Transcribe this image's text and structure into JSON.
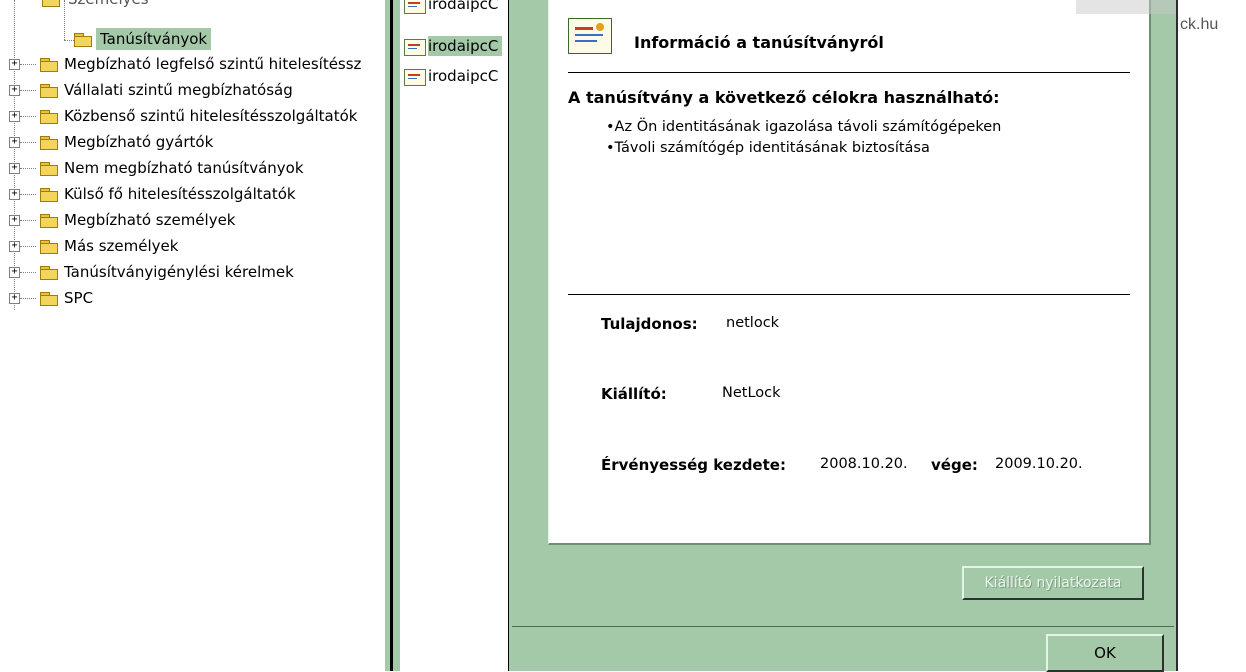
{
  "tree": {
    "top_partial_label": "Személyes",
    "selected_child_label": "Tanúsítványok",
    "items": [
      {
        "label": "Megbízható legfelső szintű hitelesítéssz"
      },
      {
        "label": "Vállalati szintű megbízhatóság"
      },
      {
        "label": "Közbenső szintű hitelesítésszolgáltatók"
      },
      {
        "label": "Megbízható gyártók"
      },
      {
        "label": "Nem megbízható tanúsítványok"
      },
      {
        "label": "Külső fő hitelesítésszolgáltatók"
      },
      {
        "label": "Megbízható személyek"
      },
      {
        "label": "Más személyek"
      },
      {
        "label": "Tanúsítványigénylési kérelmek"
      },
      {
        "label": "SPC"
      }
    ],
    "expander_symbol": "+"
  },
  "cert_list": {
    "items": [
      {
        "label": "irodaipcC"
      },
      {
        "label": "irodaipcC"
      },
      {
        "label": "irodaipcC"
      }
    ]
  },
  "dialog": {
    "info_title": "Információ a tanúsítványról",
    "purpose_heading": "A tanúsítvány a következő célokra használható:",
    "purposes": [
      "•Az Ön identitásának igazolása távoli számítógépeken",
      "•Távoli számítógép identitásának biztosítása"
    ],
    "owner_label": "Tulajdonos:",
    "owner_value": "netlock",
    "issuer_label": "Kiállító:",
    "issuer_value": "NetLock",
    "validity_label": "Érvényesség kezdete:",
    "validity_start": "2008.10.20.",
    "validity_end_label": "vége:",
    "validity_end": "2009.10.20.",
    "issuer_statement_button": "Kiállító nyilatkozata",
    "ok_button": "OK"
  },
  "background_site_text": "ck.hu",
  "colors": {
    "dialog_bg": "#a3c9a8",
    "selection": "#a3c9a8",
    "folder": "#f2d55a"
  }
}
